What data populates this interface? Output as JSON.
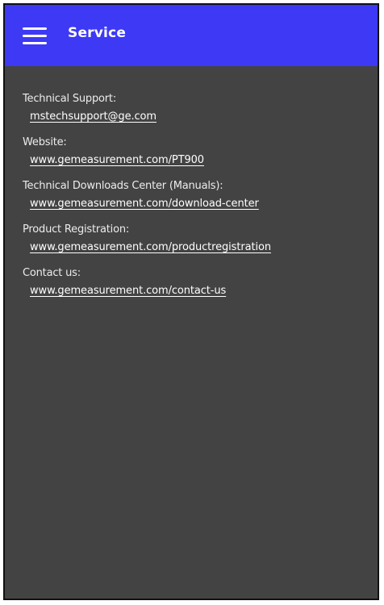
{
  "colors": {
    "app_bar": "#3d39f5",
    "background": "#434343",
    "text": "#ffffff"
  },
  "header": {
    "menu_icon": "hamburger-menu-icon",
    "title": "Service"
  },
  "service": {
    "items": [
      {
        "label": "Technical Support:",
        "link": "mstechsupport@ge.com"
      },
      {
        "label": "Website:",
        "link": "www.gemeasurement.com/PT900"
      },
      {
        "label": "Technical Downloads Center (Manuals):",
        "link": "www.gemeasurement.com/download-center"
      },
      {
        "label": "Product Registration:",
        "link": "www.gemeasurement.com/productregistration"
      },
      {
        "label": "Contact us:",
        "link": "www.gemeasurement.com/contact-us"
      }
    ]
  }
}
